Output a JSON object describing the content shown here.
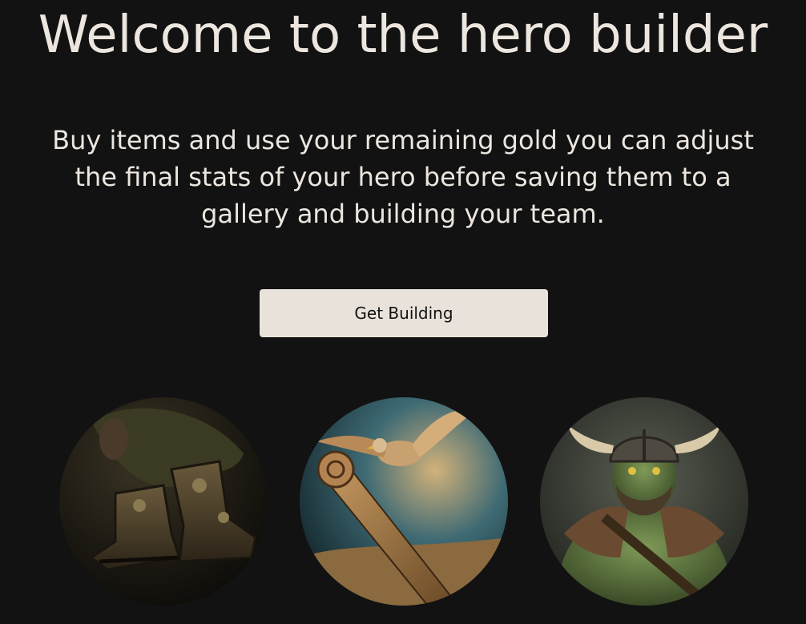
{
  "hero": {
    "title": "Welcome to the hero builder",
    "intro": "Buy items and use your remaining gold you can adjust the final stats of your hero before saving them to a gallery and building your team.",
    "cta_label": "Get Building"
  },
  "gallery": {
    "items": [
      {
        "icon": "boots-portrait"
      },
      {
        "icon": "staff-eagle-portrait"
      },
      {
        "icon": "orc-viking-portrait"
      }
    ]
  },
  "colors": {
    "background": "#121212",
    "text": "#ece6df",
    "button_bg": "#e8e2da",
    "button_text": "#121212"
  }
}
